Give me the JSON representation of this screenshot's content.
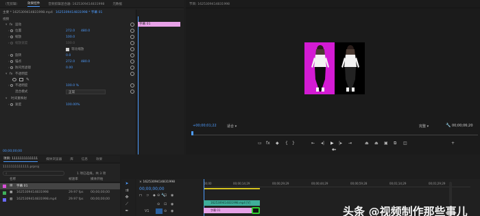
{
  "effect_controls": {
    "tabs": [
      "（无剪辑）",
      "效果控件",
      "音频剪辑混合器: 1625309414831998",
      "元数据"
    ],
    "source_label": "主要 * 1625309414831998.mp4",
    "sequence_label": "1625309414831998 * 字幕 01",
    "mini_clip_label": "字幕 01",
    "section_video": "视频",
    "rows": [
      {
        "label": "运动",
        "v1": "",
        "v2": ""
      },
      {
        "label": "位置",
        "v1": "272.0",
        "v2": "480.0"
      },
      {
        "label": "缩放",
        "v1": "100.0",
        "v2": ""
      },
      {
        "label": "缩放宽度",
        "v1": "100.0",
        "v2": ""
      },
      {
        "label": "等比缩放",
        "v1": "",
        "v2": ""
      },
      {
        "label": "旋转",
        "v1": "0.0",
        "v2": ""
      },
      {
        "label": "锚点",
        "v1": "272.0",
        "v2": "480.0"
      },
      {
        "label": "防闪烁滤镜",
        "v1": "0.00",
        "v2": ""
      },
      {
        "label": "不透明度",
        "v1": "",
        "v2": ""
      },
      {
        "label": "不透明度",
        "v1": "100.0 %",
        "v2": ""
      },
      {
        "label": "混合模式",
        "v1": "正常",
        "v2": ""
      },
      {
        "label": "时间重映射",
        "v1": "",
        "v2": ""
      },
      {
        "label": "速度",
        "v1": "100.00%",
        "v2": ""
      }
    ],
    "timecode": "00;00;00;00"
  },
  "program": {
    "title": "节目: 1625309414831998",
    "timecode_left": "+00;00;01;22",
    "fit": "适合",
    "quality": "完整",
    "timecode_right": "00;00;06;20"
  },
  "project": {
    "tabs": [
      "项目: 1111111111111",
      "媒体浏览器",
      "库",
      "信息",
      "效果"
    ],
    "file": "1111111111111.prproj",
    "selection": "1 项已选择，共 3 项",
    "columns": [
      "名称",
      "帧速率",
      "媒体开始"
    ],
    "items": [
      {
        "name": "字幕 01",
        "fps": "",
        "start": "",
        "color": "#d94fd9"
      },
      {
        "name": "1625309414831998",
        "fps": "29.97 fps",
        "start": "00;00;00;00",
        "color": "#3fb05b"
      },
      {
        "name": "1625309414831998.mp4",
        "fps": "29.97 fps",
        "start": "00;00;00;00",
        "color": "#6a6aff"
      }
    ]
  },
  "timeline": {
    "sequence_tab": "1625309414831998",
    "timecode": "00;00;00;00",
    "ruler": [
      "00;00",
      "00;00;14;29",
      "00;00;29;29",
      "00;00;44;29",
      "00;00;59;28",
      "00;01;14;29",
      "00;01;29;29",
      "00;01;44;29"
    ],
    "clip_video": "1625309414831998.mp4 [V]",
    "clip_title": "字幕 01",
    "track_labels": [
      "V2",
      "V1"
    ]
  },
  "watermark": "头条 @视频制作那些事儿"
}
